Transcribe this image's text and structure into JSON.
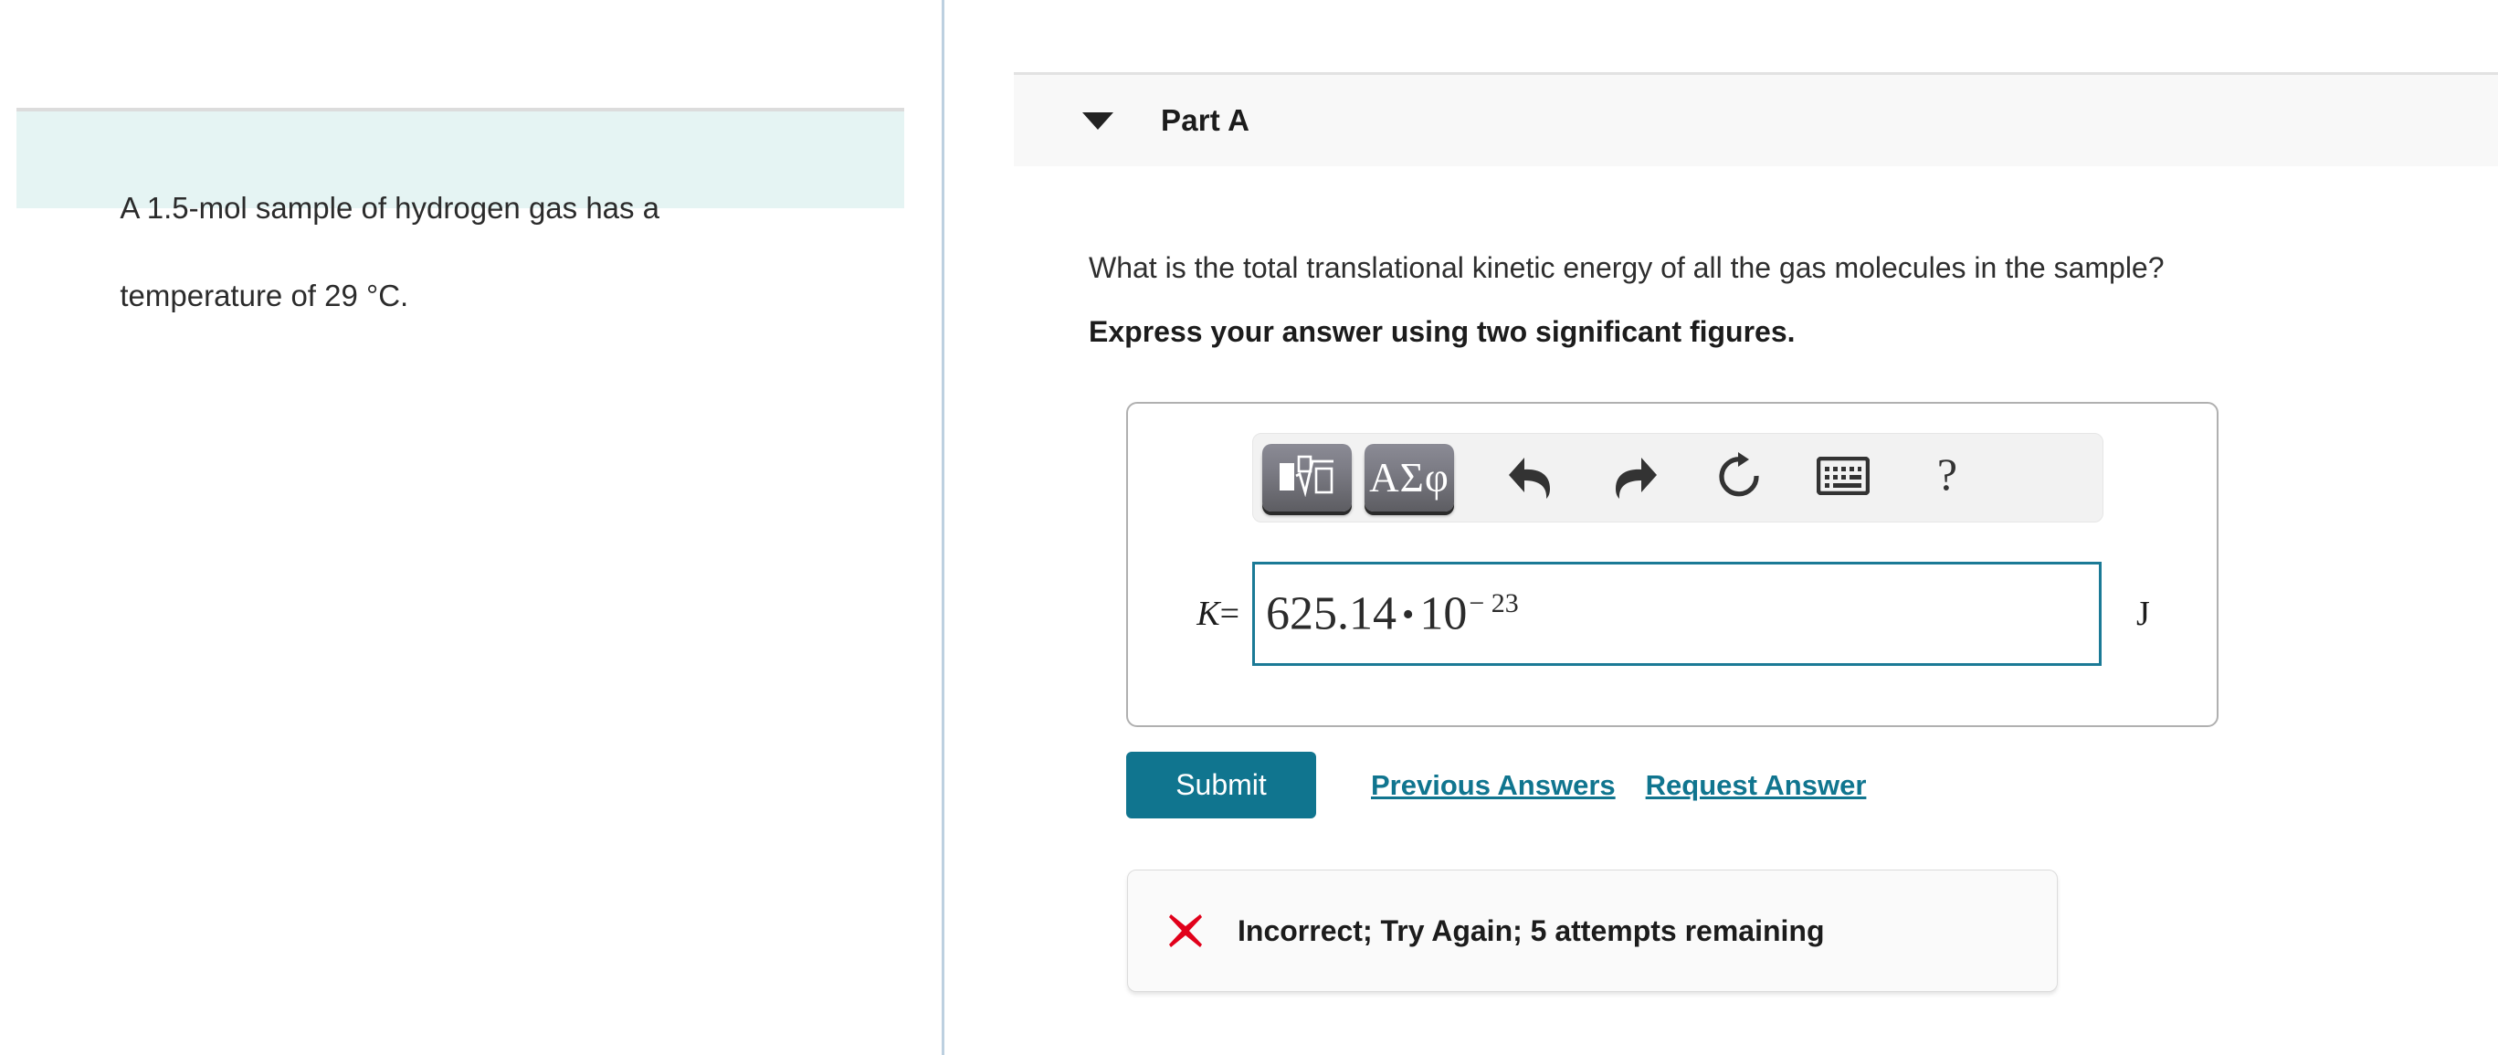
{
  "left_panel": {
    "problem_text_line1": "A 1.5-mol sample of hydrogen gas has a",
    "problem_text_line2": "temperature of 29 °C.",
    "problem_quantity": "1.5-mol",
    "problem_temperature": "29",
    "problem_temperature_unit": "°C",
    "box_background": "#e5f4f3"
  },
  "part": {
    "title": "Part A",
    "caret_icon": "triangle-down-icon",
    "expanded": true,
    "header_background": "#f8f8f8"
  },
  "question": {
    "prompt": "What is the total translational kinetic energy of all the gas molecules in the sample?",
    "instruction": "Express your answer using two significant figures."
  },
  "math_toolbar": {
    "buttons": [
      {
        "name": "template-palette-button",
        "icon": "square-root-template-icon",
        "label": ""
      },
      {
        "name": "greek-symbols-button",
        "icon": "greek-letters-icon",
        "label": "ΑΣφ"
      },
      {
        "name": "undo-button",
        "icon": "undo-arrow-icon",
        "label": ""
      },
      {
        "name": "redo-button",
        "icon": "redo-arrow-icon",
        "label": ""
      },
      {
        "name": "reset-button",
        "icon": "refresh-circle-icon",
        "label": ""
      },
      {
        "name": "keyboard-button",
        "icon": "keyboard-icon",
        "label": ""
      },
      {
        "name": "help-button",
        "icon": "question-mark-icon",
        "label": "?"
      }
    ]
  },
  "answer": {
    "variable": "K",
    "equals": "=",
    "mantissa": "625.14",
    "operator": "•",
    "base": "10",
    "exponent": "− 23",
    "full_value": "625.14 • 10−23",
    "unit": "J",
    "input_border_color": "#1b7a96"
  },
  "actions": {
    "submit_label": "Submit",
    "previous_answers_label": "Previous Answers",
    "request_answer_label": "Request Answer",
    "accent_color": "#10758f"
  },
  "feedback": {
    "icon": "x-mark-icon",
    "icon_color": "#e1001a",
    "message": "Incorrect; Try Again; 5 attempts remaining",
    "attempts_remaining": "5"
  }
}
